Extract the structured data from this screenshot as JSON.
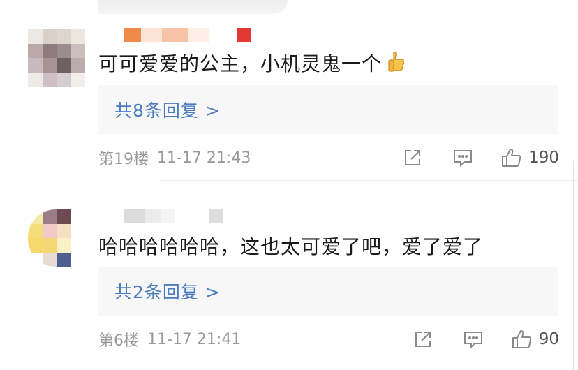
{
  "comments": [
    {
      "content": "可可爱爱的公主，小机灵鬼一个",
      "emoji": "thumbs-up-emoji",
      "reply_link": "共8条回复 >",
      "floor": "第19楼",
      "time": "11-17 21:43",
      "likes": "190"
    },
    {
      "content": "哈哈哈哈哈哈，这也太可爱了吧，爱了爱了",
      "reply_link": "共2条回复 >",
      "floor": "第6楼",
      "time": "11-17 21:41",
      "likes": "90"
    }
  ],
  "colors": {
    "link": "#4c7cc0",
    "meta": "#9a9a9a",
    "reply_bg": "#f7f7f7",
    "text": "#1a1a1a"
  }
}
